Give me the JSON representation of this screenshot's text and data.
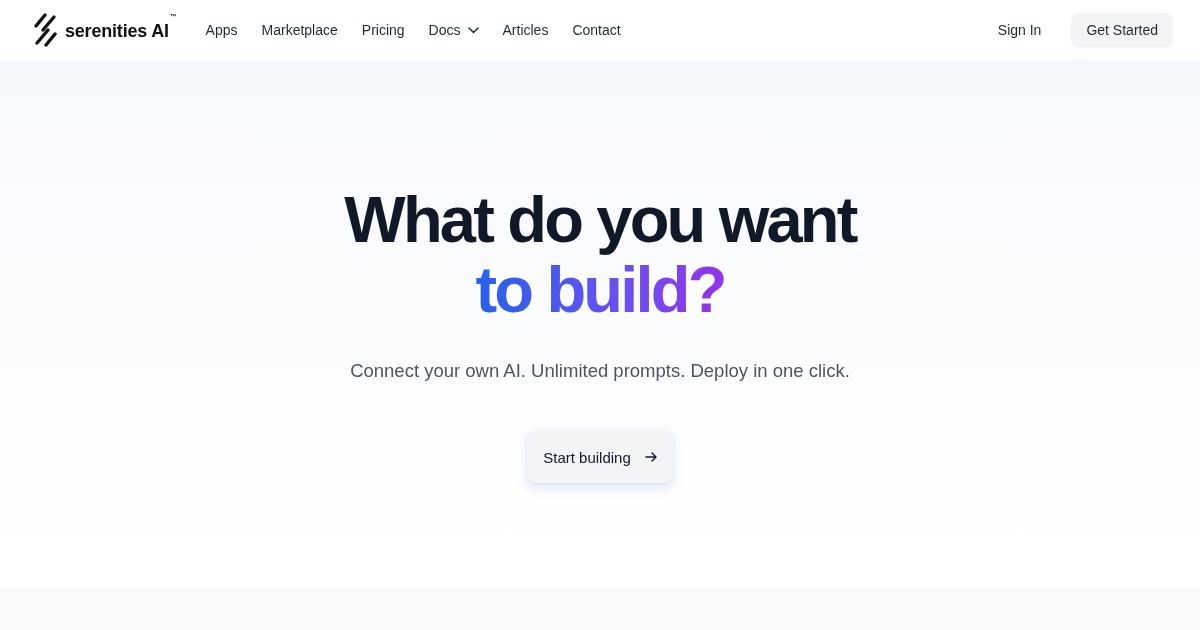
{
  "header": {
    "logo": {
      "name": "serenities AI",
      "trademark": "™"
    },
    "nav": [
      {
        "label": "Apps",
        "kind": "link"
      },
      {
        "label": "Marketplace",
        "kind": "link"
      },
      {
        "label": "Pricing",
        "kind": "link"
      },
      {
        "label": "Docs",
        "kind": "dropdown"
      },
      {
        "label": "Articles",
        "kind": "link"
      },
      {
        "label": "Contact",
        "kind": "link"
      }
    ],
    "sign_in": "Sign In",
    "get_started": "Get Started"
  },
  "hero": {
    "title": "What do you want",
    "title_highlight": "to build?",
    "subtitle": "Connect your own AI. Unlimited prompts. Deploy in one click.",
    "cta": "Start building"
  }
}
